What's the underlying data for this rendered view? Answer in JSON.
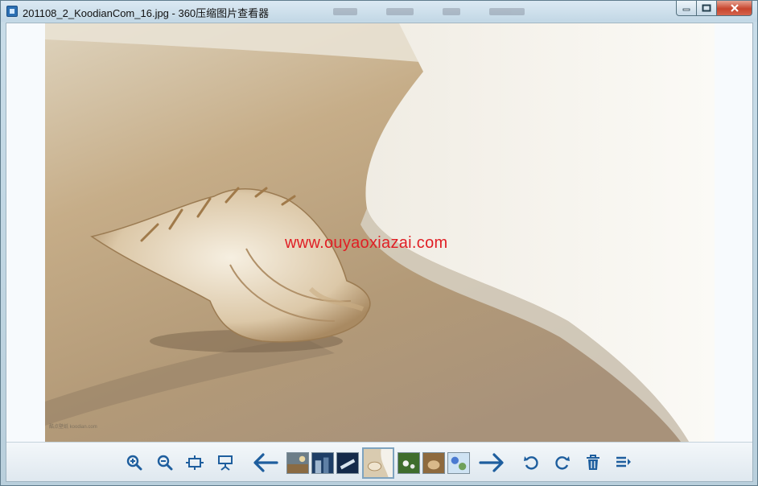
{
  "window": {
    "title": "201108_2_KoodianCom_16.jpg - 360压缩图片查看器",
    "controls": [
      "minimize",
      "maximize",
      "close"
    ]
  },
  "viewer": {
    "image_file": "201108_2_KoodianCom_16.jpg",
    "watermark": "www.ouyaoxiazai.com",
    "photo_credit": "酷点壁纸 koodian.com"
  },
  "toolbar": {
    "buttons": [
      {
        "name": "zoom-in",
        "icon": "zoom-in-icon"
      },
      {
        "name": "zoom-out",
        "icon": "zoom-out-icon"
      },
      {
        "name": "fit-window",
        "icon": "fit-window-icon"
      },
      {
        "name": "slideshow",
        "icon": "slideshow-icon"
      },
      {
        "name": "previous",
        "icon": "arrow-left-icon"
      },
      {
        "name": "next",
        "icon": "arrow-right-icon"
      },
      {
        "name": "rotate-left",
        "icon": "rotate-ccw-icon"
      },
      {
        "name": "rotate-right",
        "icon": "rotate-cw-icon"
      },
      {
        "name": "delete",
        "icon": "trash-icon"
      },
      {
        "name": "more",
        "icon": "menu-list-icon"
      }
    ],
    "thumbnails_count": 7,
    "active_thumbnail": 4
  },
  "colors": {
    "accent": "#1e5e9e",
    "watermark": "#e01e24",
    "toolbar_bg": "#e8eff4"
  }
}
